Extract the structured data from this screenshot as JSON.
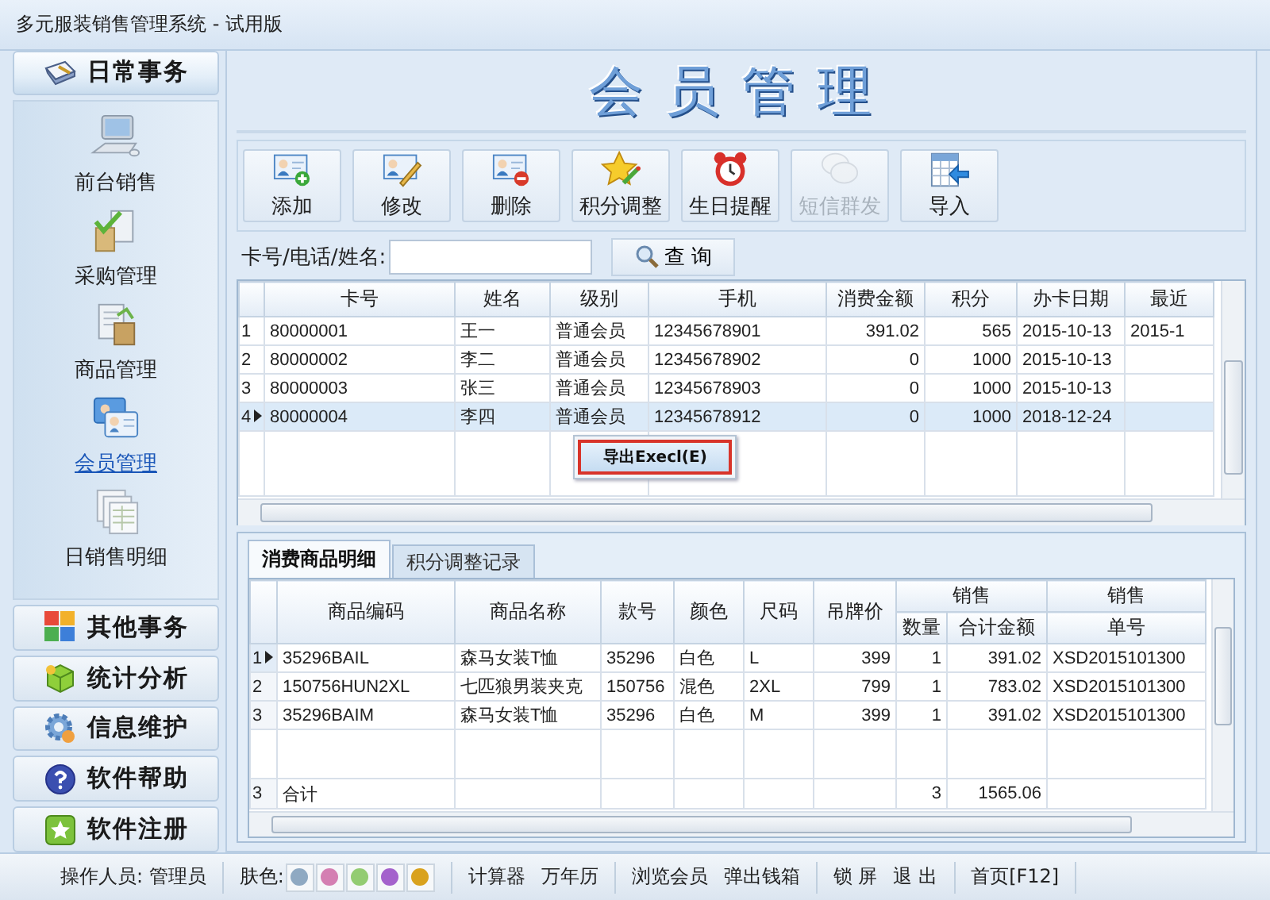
{
  "window": {
    "title": "多元服装销售管理系统 - 试用版"
  },
  "sidebar": {
    "sections": [
      {
        "label": "日常事务",
        "expanded": true,
        "items": [
          {
            "label": "前台销售",
            "selected": false
          },
          {
            "label": "采购管理",
            "selected": false
          },
          {
            "label": "商品管理",
            "selected": false
          },
          {
            "label": "会员管理",
            "selected": true
          },
          {
            "label": "日销售明细",
            "selected": false
          }
        ]
      },
      {
        "label": "其他事务",
        "expanded": false
      },
      {
        "label": "统计分析",
        "expanded": false
      },
      {
        "label": "信息维护",
        "expanded": false
      },
      {
        "label": "软件帮助",
        "expanded": false
      },
      {
        "label": "软件注册",
        "expanded": false
      }
    ]
  },
  "page_title": "会员管理",
  "toolbar": [
    {
      "label": "添加",
      "disabled": false
    },
    {
      "label": "修改",
      "disabled": false
    },
    {
      "label": "删除",
      "disabled": false
    },
    {
      "label": "积分调整",
      "disabled": false
    },
    {
      "label": "生日提醒",
      "disabled": false
    },
    {
      "label": "短信群发",
      "disabled": true
    },
    {
      "label": "导入",
      "disabled": false
    }
  ],
  "search": {
    "label": "卡号/电话/姓名:",
    "button": "查 询"
  },
  "members_table": {
    "columns": [
      "卡号",
      "姓名",
      "级别",
      "手机",
      "消费金额",
      "积分",
      "办卡日期",
      "最近"
    ],
    "rows": [
      {
        "number": "1",
        "selected": false,
        "cells": [
          "80000001",
          "王一",
          "普通会员",
          "12345678901",
          "391.02",
          "565",
          "2015-10-13",
          "2015-1"
        ]
      },
      {
        "number": "2",
        "selected": false,
        "cells": [
          "80000002",
          "李二",
          "普通会员",
          "12345678902",
          "0",
          "1000",
          "2015-10-13",
          null
        ]
      },
      {
        "number": "3",
        "selected": false,
        "cells": [
          "80000003",
          "张三",
          "普通会员",
          "12345678903",
          "0",
          "1000",
          "2015-10-13",
          null
        ]
      },
      {
        "number": "4",
        "selected": true,
        "cells": [
          "80000004",
          "李四",
          "普通会员",
          "12345678912",
          "0",
          "1000",
          "2018-12-24",
          null
        ]
      }
    ]
  },
  "context_menu": {
    "items": [
      "导出Execl(E)"
    ]
  },
  "detail_tabs": [
    {
      "label": "消费商品明细",
      "selected": true
    },
    {
      "label": "积分调整记录",
      "selected": false
    }
  ],
  "detail_table": {
    "columns": [
      {
        "label": "商品编码"
      },
      {
        "label": "商品名称"
      },
      {
        "label": "款号"
      },
      {
        "label": "颜色"
      },
      {
        "label": "尺码"
      },
      {
        "label": "吊牌价"
      },
      {
        "label": "销售",
        "colspan": 2,
        "subcolumns": [
          "数量",
          "合计金额"
        ]
      },
      {
        "label": "销售",
        "subcolumns": [
          "单号"
        ]
      }
    ],
    "rows": [
      {
        "number": "1",
        "selected": true,
        "cells": [
          "35296BAIL",
          "森马女装T恤",
          "35296",
          "白色",
          "L",
          "399",
          "1",
          "391.02",
          "XSD2015101300"
        ]
      },
      {
        "number": "2",
        "selected": false,
        "cells": [
          "150756HUN2XL",
          "七匹狼男装夹克",
          "150756",
          "混色",
          "2XL",
          "799",
          "1",
          "783.02",
          "XSD2015101300"
        ]
      },
      {
        "number": "3",
        "selected": false,
        "cells": [
          "35296BAIM",
          "森马女装T恤",
          "35296",
          "白色",
          "M",
          "399",
          "1",
          "391.02",
          "XSD2015101300"
        ]
      }
    ],
    "footer": {
      "number": "3",
      "cells": [
        "合计",
        null,
        null,
        null,
        null,
        null,
        "3",
        "1565.06",
        null
      ]
    }
  },
  "status_bar": {
    "operator": "操作人员: 管理员",
    "skin_label": "肤色:",
    "skins": [
      {
        "color": "#8fa9c2"
      },
      {
        "color": "#d47fb2"
      },
      {
        "color": "#93cc72"
      },
      {
        "color": "#a462cc"
      },
      {
        "color": "#d9a21e"
      }
    ],
    "groups": [
      [
        "计算器",
        "万年历"
      ],
      [
        "浏览会员",
        "弹出钱箱"
      ],
      [
        "锁 屏",
        "退 出"
      ],
      [
        "首页[F12]"
      ]
    ]
  }
}
